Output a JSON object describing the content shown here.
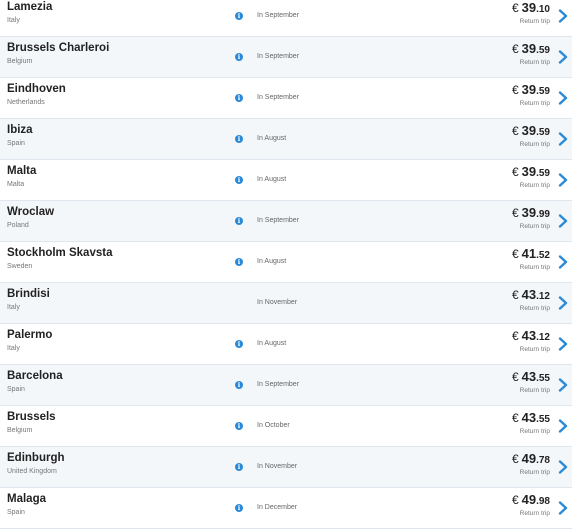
{
  "colors": {
    "accent": "#2a8ad8",
    "row_alt": "#f4f7fa",
    "divider": "#dfe6ee"
  },
  "icons": {
    "info": "info-icon",
    "chevron": "chevron-right-icon"
  },
  "currency": "€",
  "trip_label": "Return trip",
  "flights": [
    {
      "city": "Lamezia",
      "country": "Italy",
      "month": "In September",
      "price_int": "39",
      "price_dec": ".10",
      "has_info": true
    },
    {
      "city": "Brussels Charleroi",
      "country": "Belgium",
      "month": "In September",
      "price_int": "39",
      "price_dec": ".59",
      "has_info": true
    },
    {
      "city": "Eindhoven",
      "country": "Netherlands",
      "month": "In September",
      "price_int": "39",
      "price_dec": ".59",
      "has_info": true
    },
    {
      "city": "Ibiza",
      "country": "Spain",
      "month": "In August",
      "price_int": "39",
      "price_dec": ".59",
      "has_info": true
    },
    {
      "city": "Malta",
      "country": "Malta",
      "month": "In August",
      "price_int": "39",
      "price_dec": ".59",
      "has_info": true
    },
    {
      "city": "Wroclaw",
      "country": "Poland",
      "month": "In September",
      "price_int": "39",
      "price_dec": ".99",
      "has_info": true
    },
    {
      "city": "Stockholm Skavsta",
      "country": "Sweden",
      "month": "In August",
      "price_int": "41",
      "price_dec": ".52",
      "has_info": true
    },
    {
      "city": "Brindisi",
      "country": "Italy",
      "month": "In November",
      "price_int": "43",
      "price_dec": ".12",
      "has_info": false
    },
    {
      "city": "Palermo",
      "country": "Italy",
      "month": "In August",
      "price_int": "43",
      "price_dec": ".12",
      "has_info": true
    },
    {
      "city": "Barcelona",
      "country": "Spain",
      "month": "In September",
      "price_int": "43",
      "price_dec": ".55",
      "has_info": true
    },
    {
      "city": "Brussels",
      "country": "Belgium",
      "month": "In October",
      "price_int": "43",
      "price_dec": ".55",
      "has_info": true
    },
    {
      "city": "Edinburgh",
      "country": "United Kingdom",
      "month": "In November",
      "price_int": "49",
      "price_dec": ".78",
      "has_info": true
    },
    {
      "city": "Malaga",
      "country": "Spain",
      "month": "In December",
      "price_int": "49",
      "price_dec": ".98",
      "has_info": true
    }
  ]
}
